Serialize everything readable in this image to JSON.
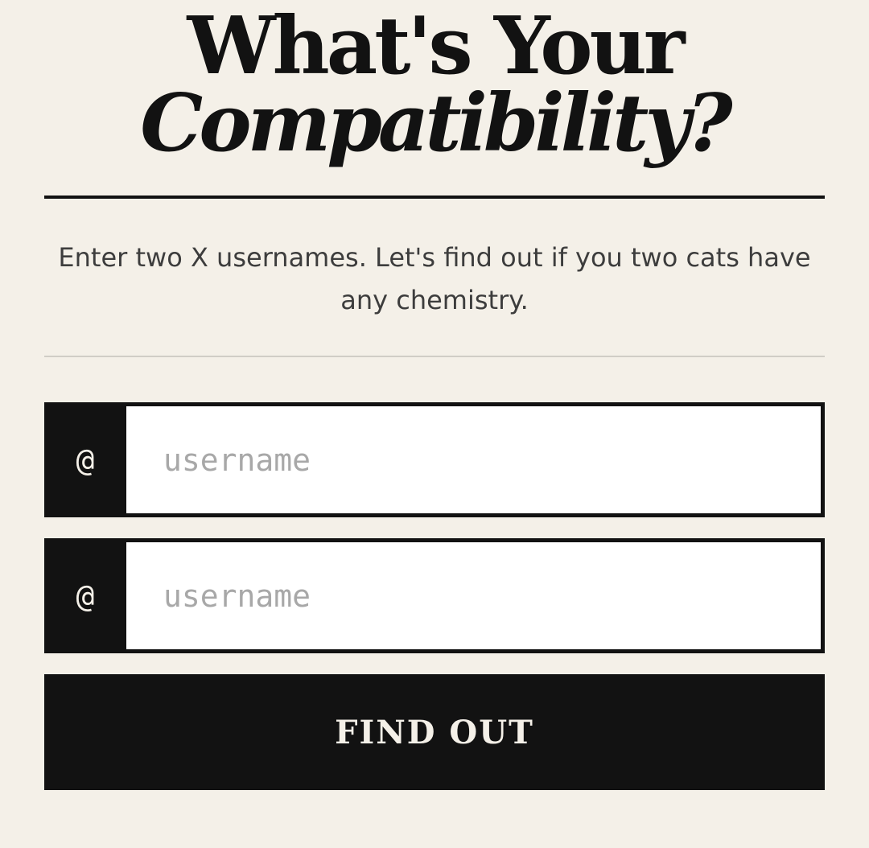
{
  "heading": {
    "line1": "What's Your",
    "line2": "Compatibility?"
  },
  "subtitle": "Enter two X usernames. Let's find out if you two cats have any chemistry.",
  "form": {
    "fields": [
      {
        "prefix": "@",
        "placeholder": "username",
        "value": ""
      },
      {
        "prefix": "@",
        "placeholder": "username",
        "value": ""
      }
    ],
    "submit_label": "FIND OUT"
  },
  "colors": {
    "background": "#f4f0e8",
    "ink": "#121212",
    "muted_text": "#3d3d3d",
    "placeholder": "#a8a8a8",
    "divider": "#d0cdc6"
  }
}
